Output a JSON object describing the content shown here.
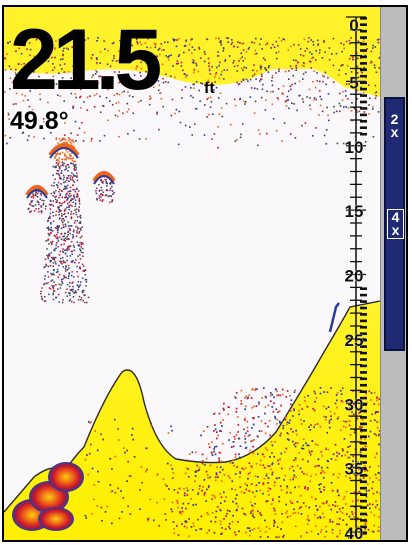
{
  "readout": {
    "depth_value": "21.5",
    "depth_unit": "ft",
    "water_temp": "49.8°"
  },
  "depth_scale": {
    "min": 0,
    "max": 40,
    "labels": [
      "0",
      "5",
      "10",
      "15",
      "20",
      "25",
      "30",
      "35",
      "40"
    ]
  },
  "zoom": {
    "marks": [
      {
        "id": "2x",
        "chars": [
          "2",
          "x"
        ]
      },
      {
        "id": "4x",
        "chars": [
          "4",
          "x"
        ]
      }
    ]
  },
  "colors": {
    "background": "#fbf8fb",
    "bottom_fill": "#fff22a",
    "return_orange": "#f06418",
    "return_red": "#c8142c",
    "return_blue": "#283c9c",
    "zoom_window": "#1e2a73",
    "sidebar": "#bcbcbc"
  }
}
